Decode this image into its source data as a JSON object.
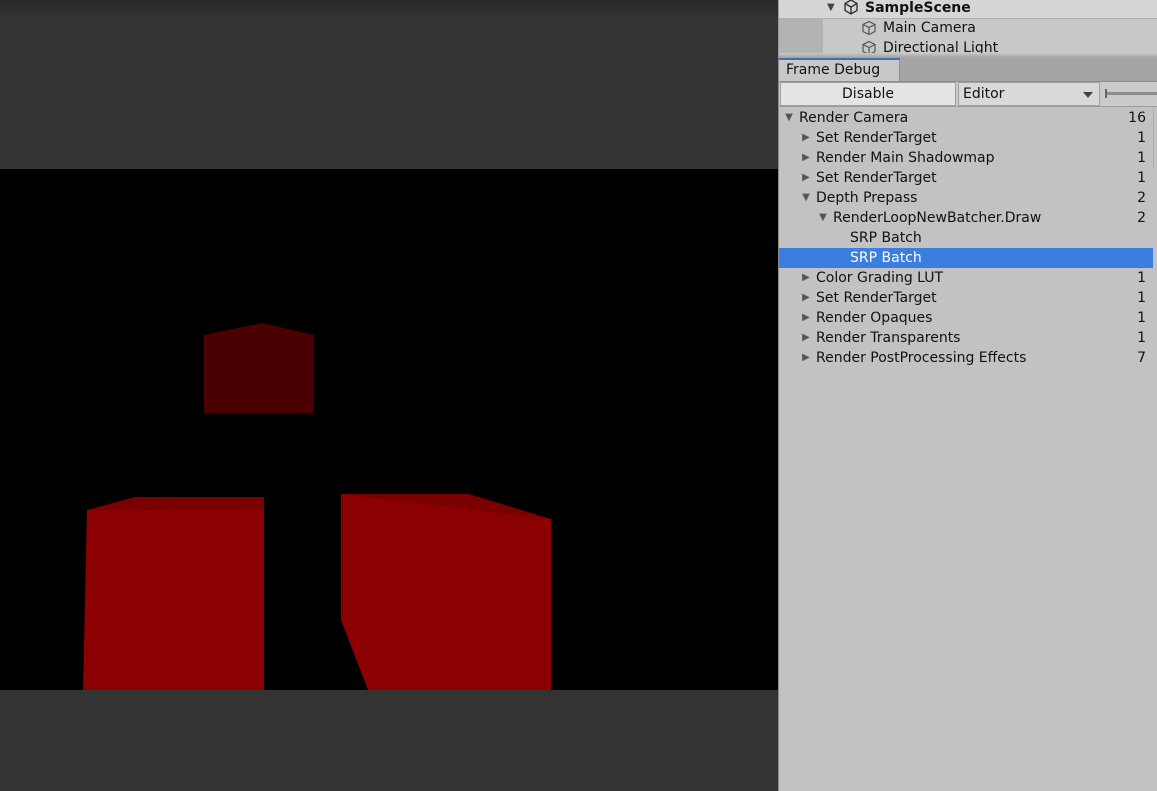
{
  "hierarchy": {
    "scene_name": "SampleScene",
    "items": [
      "Main Camera",
      "Directional Light"
    ]
  },
  "frame_debug": {
    "tab_label": "Frame Debug",
    "disable_label": "Disable",
    "target_dropdown": "Editor",
    "tree": [
      {
        "label": "Render Camera",
        "count": "16",
        "depth": 0,
        "expander": "expanded",
        "selected": false
      },
      {
        "label": "Set RenderTarget",
        "count": "1",
        "depth": 1,
        "expander": "collapsed",
        "selected": false
      },
      {
        "label": "Render Main Shadowmap",
        "count": "1",
        "depth": 1,
        "expander": "collapsed",
        "selected": false
      },
      {
        "label": "Set RenderTarget",
        "count": "1",
        "depth": 1,
        "expander": "collapsed",
        "selected": false
      },
      {
        "label": "Depth Prepass",
        "count": "2",
        "depth": 1,
        "expander": "expanded",
        "selected": false
      },
      {
        "label": "RenderLoopNewBatcher.Draw",
        "count": "2",
        "depth": 2,
        "expander": "expanded",
        "selected": false
      },
      {
        "label": "SRP Batch",
        "count": "",
        "depth": 3,
        "expander": "none",
        "selected": false
      },
      {
        "label": "SRP Batch",
        "count": "",
        "depth": 3,
        "expander": "none",
        "selected": true
      },
      {
        "label": "Color Grading LUT",
        "count": "1",
        "depth": 1,
        "expander": "collapsed",
        "selected": false
      },
      {
        "label": "Set RenderTarget",
        "count": "1",
        "depth": 1,
        "expander": "collapsed",
        "selected": false
      },
      {
        "label": "Render Opaques",
        "count": "1",
        "depth": 1,
        "expander": "collapsed",
        "selected": false
      },
      {
        "label": "Render Transparents",
        "count": "1",
        "depth": 1,
        "expander": "collapsed",
        "selected": false
      },
      {
        "label": "Render PostProcessing Effects",
        "count": "7",
        "depth": 1,
        "expander": "collapsed",
        "selected": false
      }
    ]
  },
  "icons": {
    "scene": "unity-logo-icon",
    "game_object": "cube-icon",
    "expanded": "triangle-down-icon",
    "collapsed": "triangle-right-icon"
  },
  "colors": {
    "selection": "#3a7ee0",
    "cube_front": "#8b0000",
    "cube_dark": "#4a0000"
  }
}
